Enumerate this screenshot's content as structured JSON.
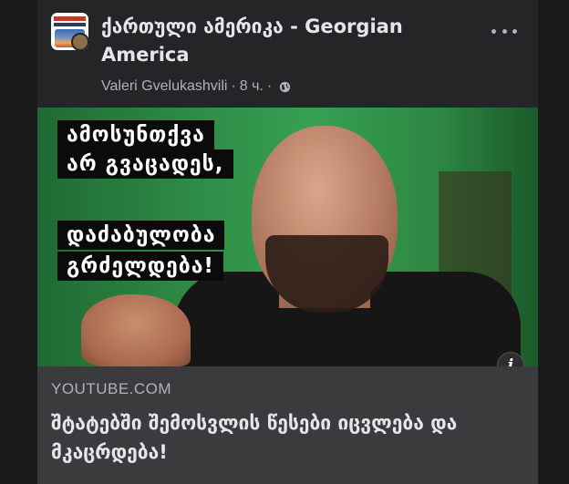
{
  "post": {
    "page_name": "ქართული ამერიკა - Georgian America",
    "author": "Valeri Gvelukashvili",
    "separator": "·",
    "time": "8 ч.",
    "privacy_icon": "globe-icon",
    "more_icon": "more-horizontal-icon"
  },
  "thumbnail": {
    "caption_lines": [
      "ამოსუნთქვა",
      "არ გვაცადეს,",
      "დაძაბულობა",
      "გრძელდება!"
    ],
    "info_label": "i"
  },
  "link": {
    "domain": "YOUTUBE.COM",
    "title": "შტატებში შემოსვლის წესები იცვლება და მკაცრდება!"
  },
  "colors": {
    "background": "#18191a",
    "card": "#242526",
    "link_area": "#3a3b3c",
    "primary_text": "#e4e6eb",
    "secondary_text": "#b0b3b8"
  }
}
